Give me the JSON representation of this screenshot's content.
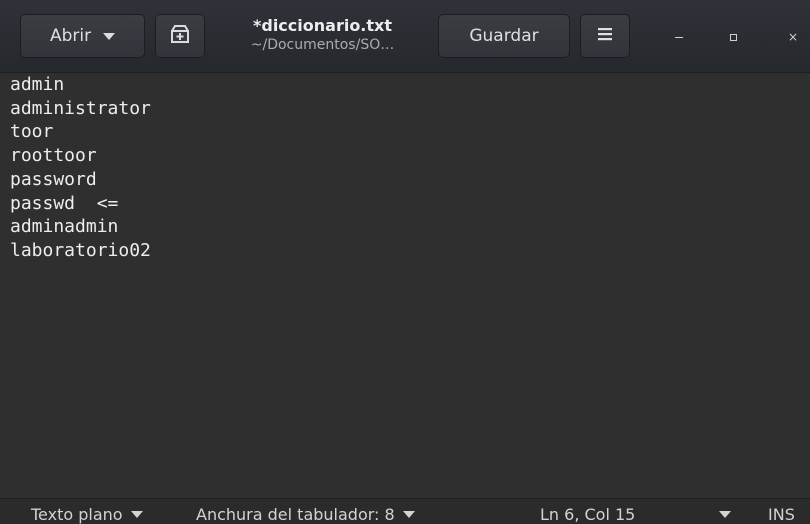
{
  "headerbar": {
    "open_label": "Abrir",
    "new_tab_icon": "new-document-icon",
    "document_title": "*diccionario.txt",
    "document_path": "~/Documentos/SO…",
    "save_label": "Guardar",
    "menu_icon": "hamburger-menu-icon",
    "window_controls": [
      "minimize",
      "maximize",
      "close"
    ],
    "close_glyph": "×"
  },
  "editor": {
    "lines": [
      "admin",
      "administrator",
      "toor",
      "roottoor",
      "password",
      "passwd\t<=",
      "adminadmin",
      "laboratorio02"
    ]
  },
  "statusbar": {
    "language": "Texto plano",
    "tab_width": "Anchura del tabulador: 8",
    "cursor_position": "Ln 6, Col 15",
    "insert_mode": "INS"
  },
  "colors": {
    "header_bg": "#2a2d32",
    "editor_bg": "#2f2f2f",
    "text": "#ededed"
  }
}
